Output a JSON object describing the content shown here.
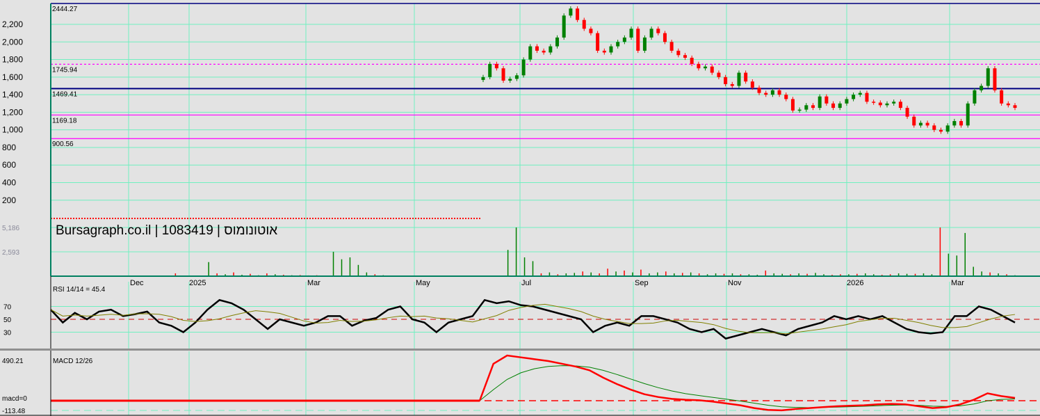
{
  "chart_data": {
    "type": "candlestick",
    "title": "Bursagraph.co.il | 1083419 | אוטונומוס",
    "colors": {
      "up": "#008000",
      "down": "#ff0000",
      "grid": "#70f0c0",
      "background": "#e3e3e3",
      "level_navy": "#000080",
      "level_magenta": "#ff00ff"
    },
    "price_axis": {
      "ticks": [
        "2,200",
        "2,000",
        "1,800",
        "1,600",
        "1,400",
        "1,200",
        "1,000",
        "800",
        "600",
        "400",
        "200"
      ],
      "tick_values": [
        2200,
        2000,
        1800,
        1600,
        1400,
        1200,
        1000,
        800,
        600,
        400,
        200
      ],
      "ylim": [
        0,
        2444.27
      ]
    },
    "levels": [
      {
        "label": "2444.27",
        "value": 2444.27,
        "style": "solid-navy"
      },
      {
        "label": "1745.94",
        "value": 1745.94,
        "style": "dashed-magenta"
      },
      {
        "label": "1469.41",
        "value": 1469.41,
        "style": "thick-navy"
      },
      {
        "label": "1169.18",
        "value": 1169.18,
        "style": "solid-magenta"
      },
      {
        "label": "900.56",
        "value": 900.56,
        "style": "solid-magenta"
      }
    ],
    "months": [
      "Dec",
      "2025",
      "Mar",
      "May",
      "Jul",
      "Sep",
      "Nov",
      "2026",
      "Mar"
    ],
    "closes": [
      1600,
      1750,
      1700,
      1560,
      1580,
      1620,
      1800,
      1950,
      1900,
      1880,
      1950,
      2050,
      2300,
      2380,
      2250,
      2150,
      2100,
      1900,
      1880,
      1950,
      2000,
      2050,
      2150,
      1900,
      2050,
      2150,
      2100,
      2000,
      1900,
      1850,
      1820,
      1750,
      1700,
      1720,
      1650,
      1600,
      1520,
      1500,
      1650,
      1550,
      1480,
      1420,
      1400,
      1450,
      1400,
      1350,
      1220,
      1230,
      1280,
      1250,
      1380,
      1300,
      1250,
      1300,
      1350,
      1400,
      1420,
      1320,
      1310,
      1280,
      1300,
      1320,
      1250,
      1150,
      1050,
      1080,
      1050,
      1000,
      980,
      1050,
      1100,
      1050,
      1300,
      1450,
      1500,
      1700,
      1450,
      1300,
      1280,
      1250
    ],
    "volume": {
      "ticks": [
        "5,186",
        "2,593"
      ],
      "tick_values": [
        5186,
        2593
      ],
      "values": [
        0,
        0,
        0,
        0,
        0,
        0,
        0,
        0,
        0,
        0,
        0,
        0,
        0,
        0,
        0,
        300,
        0,
        0,
        0,
        1500,
        300,
        200,
        400,
        150,
        250,
        100,
        300,
        200,
        150,
        100,
        120,
        80,
        100,
        0,
        2600,
        1800,
        2000,
        1200,
        400,
        200,
        100,
        0,
        0,
        0,
        0,
        0,
        0,
        0,
        0,
        0,
        0,
        0,
        0,
        0,
        0,
        2800,
        5186,
        2000,
        1600,
        300,
        400,
        200,
        300,
        350,
        500,
        400,
        300,
        800,
        500,
        600,
        400,
        700,
        300,
        400,
        500,
        300,
        350,
        400,
        300,
        200,
        300,
        250,
        300,
        200,
        200,
        150,
        600,
        300,
        250,
        200,
        300,
        250,
        350,
        200,
        150,
        200,
        200,
        250,
        300,
        200,
        150,
        200,
        300,
        250,
        250,
        300,
        200,
        5186,
        2400,
        2200,
        4600,
        1000,
        500,
        400,
        300,
        200,
        100
      ],
      "up": [
        0,
        0,
        0,
        0,
        0,
        0,
        0,
        0,
        0,
        0,
        0,
        0,
        0,
        0,
        0,
        0,
        0,
        0,
        0,
        1,
        0,
        1,
        0,
        1,
        0,
        1,
        0,
        1,
        0,
        1,
        0,
        1,
        0,
        0,
        1,
        1,
        1,
        1,
        1,
        0,
        1,
        0,
        0,
        0,
        0,
        0,
        0,
        0,
        0,
        0,
        0,
        0,
        0,
        0,
        0,
        1,
        1,
        1,
        1,
        0,
        1,
        0,
        1,
        1,
        0,
        1,
        0,
        0,
        1,
        0,
        1,
        0,
        1,
        1,
        0,
        1,
        0,
        1,
        0,
        1,
        1,
        0,
        1,
        0,
        1,
        1,
        0,
        1,
        1,
        0,
        1,
        0,
        1,
        1,
        0,
        0,
        1,
        0,
        1,
        1,
        0,
        0,
        1,
        1,
        0,
        1,
        1,
        0,
        1,
        1,
        1,
        1,
        1,
        0,
        1,
        0,
        1,
        0,
        1,
        0
      ]
    },
    "rsi": {
      "label": "RSI 14/14 = 45.4",
      "ticks": [
        "70",
        "50",
        "30"
      ],
      "tick_values": [
        70,
        50,
        30
      ],
      "values": [
        65,
        45,
        60,
        50,
        62,
        65,
        55,
        58,
        62,
        45,
        40,
        30,
        45,
        65,
        80,
        75,
        65,
        50,
        35,
        50,
        45,
        40,
        45,
        55,
        55,
        40,
        48,
        52,
        65,
        70,
        50,
        45,
        30,
        45,
        50,
        55,
        80,
        75,
        78,
        72,
        70,
        65,
        60,
        55,
        50,
        30,
        40,
        45,
        40,
        55,
        55,
        50,
        45,
        35,
        30,
        35,
        20,
        25,
        30,
        35,
        30,
        25,
        35,
        40,
        45,
        55,
        50,
        55,
        50,
        55,
        45,
        35,
        30,
        28,
        30,
        55,
        55,
        70,
        65,
        55,
        45
      ]
    },
    "macd": {
      "label": "MACD 12/26",
      "max_label": "490.21",
      "zero_label": "macd=0",
      "min_label": "-113.48",
      "ylim": [
        -113.48,
        490.21
      ],
      "values": [
        0,
        400,
        490,
        470,
        450,
        430,
        400,
        370,
        330,
        250,
        180,
        120,
        70,
        40,
        20,
        10,
        5,
        -10,
        -30,
        -50,
        -80,
        -100,
        -105,
        -90,
        -80,
        -70,
        -60,
        -55,
        -50,
        -40,
        -35,
        -40,
        -60,
        -80,
        -70,
        -40,
        10,
        80,
        50,
        30
      ]
    }
  }
}
